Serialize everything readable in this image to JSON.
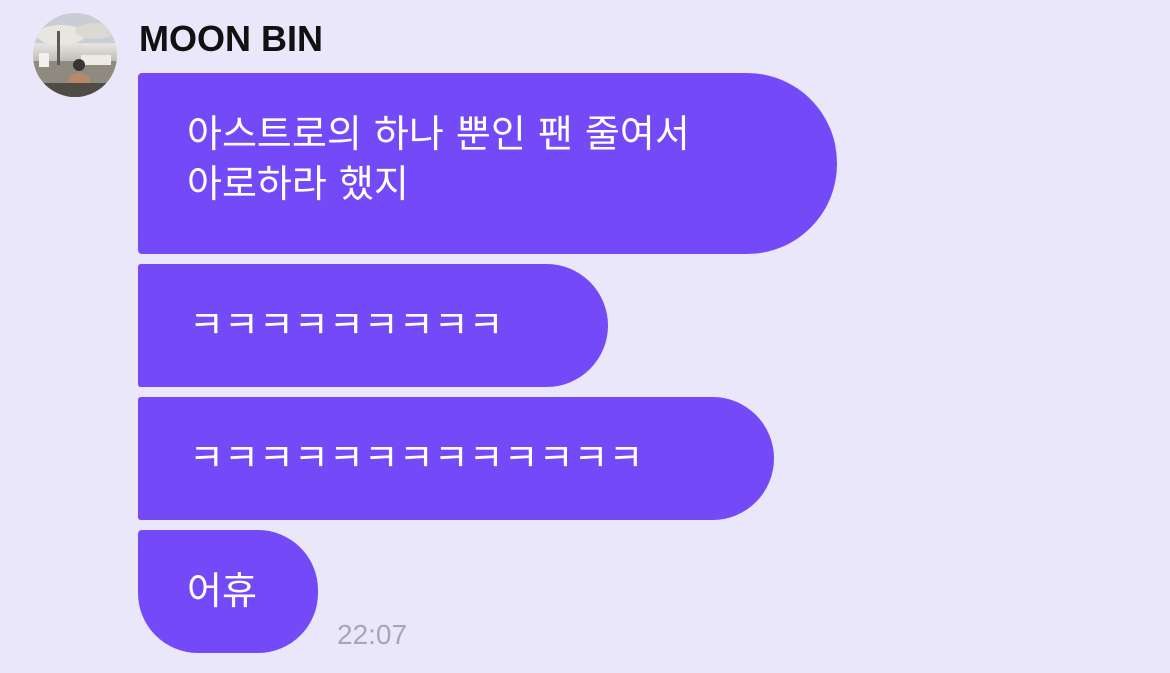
{
  "chat": {
    "sender": {
      "name": "MOON BIN"
    },
    "messages": [
      {
        "lines": [
          "아스트로의 하나 뿐인 팬 줄여서",
          "아로하라 했지"
        ]
      },
      {
        "lines": [
          "ㅋㅋㅋㅋㅋㅋㅋㅋㅋ"
        ]
      },
      {
        "lines": [
          "ㅋㅋㅋㅋㅋㅋㅋㅋㅋㅋㅋㅋㅋ"
        ]
      },
      {
        "lines": [
          "어휴"
        ]
      }
    ],
    "timestamp": "22:07"
  },
  "colors": {
    "background": "#ebe7fb",
    "bubble": "#7449f8",
    "bubble_text": "#ffffff",
    "name_text": "#111111",
    "timestamp_text": "#a9a4b8"
  }
}
